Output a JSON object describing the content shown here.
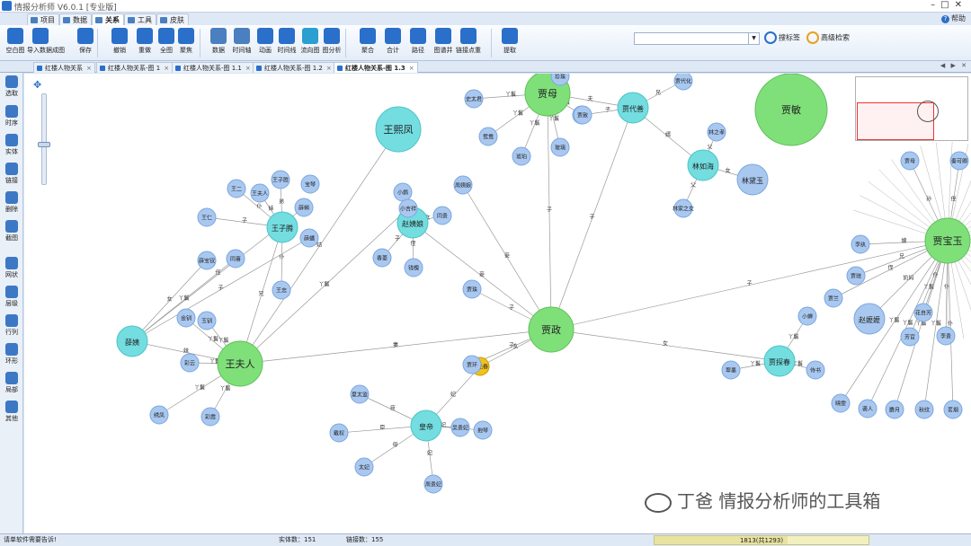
{
  "app": {
    "title": "情报分析师 V6.0.1 [专业版]"
  },
  "menu": {
    "tabs": [
      {
        "label": "项目"
      },
      {
        "label": "数据"
      },
      {
        "label": "关系"
      },
      {
        "label": "工具"
      },
      {
        "label": "皮肤"
      }
    ],
    "help": "帮助"
  },
  "ribbon": {
    "buttons": [
      {
        "label": "空白图"
      },
      {
        "label": "导入数据成图"
      },
      {
        "label": "保存"
      },
      {
        "label": "撤销"
      },
      {
        "label": "重做"
      },
      {
        "label": "全图"
      },
      {
        "label": "聚焦"
      },
      {
        "label": "数据"
      },
      {
        "label": "时间轴"
      },
      {
        "label": "动画"
      },
      {
        "label": "时间线"
      },
      {
        "label": "流向图"
      },
      {
        "label": "图分析"
      },
      {
        "label": "聚合"
      },
      {
        "label": "合计"
      },
      {
        "label": "路径"
      },
      {
        "label": "图谱并"
      },
      {
        "label": "链接点重"
      },
      {
        "label": "提取"
      }
    ],
    "search_placeholder": "",
    "tag_search": "搜标签",
    "advanced_search": "高级检索"
  },
  "doc_tabs": [
    {
      "label": "红楼人物关系"
    },
    {
      "label": "红楼人物关系-图 1"
    },
    {
      "label": "红楼人物关系-图 1.1"
    },
    {
      "label": "红楼人物关系-图 1.2"
    },
    {
      "label": "红楼人物关系-图 1.3"
    }
  ],
  "left_tools": [
    {
      "label": "选取"
    },
    {
      "label": "时序"
    },
    {
      "label": "实体"
    },
    {
      "label": "链接"
    },
    {
      "label": "删除"
    },
    {
      "label": "截图"
    },
    {
      "label": "网状"
    },
    {
      "label": "层级"
    },
    {
      "label": "行列"
    },
    {
      "label": "环形"
    },
    {
      "label": "局部"
    },
    {
      "label": "其他"
    }
  ],
  "graph": {
    "nodes": [
      {
        "id": "wangxifeng",
        "label": "王熙凤",
        "type": "cyan",
        "size": "big"
      },
      {
        "id": "jiamu",
        "label": "贾母",
        "type": "green",
        "size": "big"
      },
      {
        "id": "jiazheng",
        "label": "贾政",
        "type": "green",
        "size": "big"
      },
      {
        "id": "wangfuren",
        "label": "王夫人",
        "type": "green",
        "size": "big"
      },
      {
        "id": "jiabaoyu",
        "label": "贾宝玉",
        "type": "green",
        "size": "big"
      },
      {
        "id": "jiamin",
        "label": "贾敏",
        "type": "green",
        "size": "huge"
      },
      {
        "id": "jiayuanchun",
        "label": "贾元春",
        "type": "gold",
        "size": "small"
      },
      {
        "id": "zhaoyiniang",
        "label": "赵姨娘",
        "type": "cyan",
        "size": "mid"
      },
      {
        "id": "jiadaishan",
        "label": "贾代善",
        "type": "cyan",
        "size": "mid"
      },
      {
        "id": "lingruhai",
        "label": "林如海",
        "type": "cyan",
        "size": "mid"
      },
      {
        "id": "lindaiyu",
        "label": "林黛玉",
        "type": "light",
        "size": "mid"
      },
      {
        "id": "wangzisheng",
        "label": "王子腾",
        "type": "cyan",
        "size": "mid"
      },
      {
        "id": "xuepan",
        "label": "薛姨",
        "type": "cyan",
        "size": "mid"
      },
      {
        "id": "huangdi",
        "label": "皇帝",
        "type": "cyan",
        "size": "mid"
      },
      {
        "id": "jiatanchun",
        "label": "贾探春",
        "type": "cyan",
        "size": "mid"
      },
      {
        "id": "zhaoyima",
        "label": "赵嬷嬷",
        "type": "light",
        "size": "mid"
      },
      {
        "id": "n01",
        "label": "史太君",
        "type": "light",
        "size": "small"
      },
      {
        "id": "n02",
        "label": "鸳鸯",
        "type": "light",
        "size": "small"
      },
      {
        "id": "n03",
        "label": "琥珀",
        "type": "light",
        "size": "small"
      },
      {
        "id": "n04",
        "label": "玻璃",
        "type": "light",
        "size": "small"
      },
      {
        "id": "n05",
        "label": "翡翠",
        "type": "light",
        "size": "small"
      },
      {
        "id": "n06",
        "label": "珍珠",
        "type": "light",
        "size": "small"
      },
      {
        "id": "n07",
        "label": "贾赦",
        "type": "light",
        "size": "small"
      },
      {
        "id": "n08",
        "label": "贾代化",
        "type": "light",
        "size": "small"
      },
      {
        "id": "n09",
        "label": "林家之女",
        "type": "light",
        "size": "small"
      },
      {
        "id": "n10",
        "label": "贾环",
        "type": "light",
        "size": "small"
      },
      {
        "id": "n11",
        "label": "贾珠",
        "type": "light",
        "size": "small"
      },
      {
        "id": "n12",
        "label": "小鹊",
        "type": "light",
        "size": "small"
      },
      {
        "id": "n13",
        "label": "钱槐",
        "type": "light",
        "size": "small"
      },
      {
        "id": "n14",
        "label": "周姨娘",
        "type": "light",
        "size": "small"
      },
      {
        "id": "n15",
        "label": "小吉祥",
        "type": "light",
        "size": "small"
      },
      {
        "id": "n16",
        "label": "金钏",
        "type": "light",
        "size": "small"
      },
      {
        "id": "n17",
        "label": "玉钏",
        "type": "light",
        "size": "small"
      },
      {
        "id": "n18",
        "label": "彩云",
        "type": "light",
        "size": "small"
      },
      {
        "id": "n19",
        "label": "彩霞",
        "type": "light",
        "size": "small"
      },
      {
        "id": "n20",
        "label": "绣凤",
        "type": "light",
        "size": "small"
      },
      {
        "id": "n21",
        "label": "王仁",
        "type": "light",
        "size": "small"
      },
      {
        "id": "n22",
        "label": "王子胜",
        "type": "light",
        "size": "small"
      },
      {
        "id": "n23",
        "label": "王夫人",
        "type": "light",
        "size": "small"
      },
      {
        "id": "n24",
        "label": "薛蝌",
        "type": "light",
        "size": "small"
      },
      {
        "id": "n25",
        "label": "薛蟠",
        "type": "light",
        "size": "small"
      },
      {
        "id": "n26",
        "label": "薛宝钗",
        "type": "light",
        "size": "small"
      },
      {
        "id": "n27",
        "label": "同喜",
        "type": "light",
        "size": "small"
      },
      {
        "id": "n28",
        "label": "同贵",
        "type": "light",
        "size": "small"
      },
      {
        "id": "n29",
        "label": "香菱",
        "type": "light",
        "size": "small"
      },
      {
        "id": "n30",
        "label": "宝琴",
        "type": "light",
        "size": "small"
      },
      {
        "id": "n31",
        "label": "王二",
        "type": "light",
        "size": "small"
      },
      {
        "id": "n32",
        "label": "王忠",
        "type": "light",
        "size": "small"
      },
      {
        "id": "n33",
        "label": "夏太监",
        "type": "light",
        "size": "small"
      },
      {
        "id": "n34",
        "label": "戴权",
        "type": "light",
        "size": "small"
      },
      {
        "id": "n35",
        "label": "太妃",
        "type": "light",
        "size": "small"
      },
      {
        "id": "n36",
        "label": "周贵妃",
        "type": "light",
        "size": "small"
      },
      {
        "id": "n37",
        "label": "吴贵妃",
        "type": "light",
        "size": "small"
      },
      {
        "id": "n38",
        "label": "抱琴",
        "type": "light",
        "size": "small"
      },
      {
        "id": "n39",
        "label": "侍书",
        "type": "light",
        "size": "small"
      },
      {
        "id": "n40",
        "label": "翠墨",
        "type": "light",
        "size": "small"
      },
      {
        "id": "n41",
        "label": "小蝉",
        "type": "light",
        "size": "small"
      },
      {
        "id": "n42",
        "label": "晴雯",
        "type": "light",
        "size": "small"
      },
      {
        "id": "n43",
        "label": "袭人",
        "type": "light",
        "size": "small"
      },
      {
        "id": "n44",
        "label": "麝月",
        "type": "light",
        "size": "small"
      },
      {
        "id": "n45",
        "label": "秋纹",
        "type": "light",
        "size": "small"
      },
      {
        "id": "n46",
        "label": "茗烟",
        "type": "light",
        "size": "small"
      },
      {
        "id": "n47",
        "label": "李贵",
        "type": "light",
        "size": "small"
      },
      {
        "id": "n48",
        "label": "芳官",
        "type": "light",
        "size": "small"
      },
      {
        "id": "n49",
        "label": "花自芳",
        "type": "light",
        "size": "small"
      },
      {
        "id": "n50",
        "label": "贾兰",
        "type": "light",
        "size": "small"
      },
      {
        "id": "n51",
        "label": "李纨",
        "type": "light",
        "size": "small"
      },
      {
        "id": "n52",
        "label": "贾琏",
        "type": "light",
        "size": "small"
      },
      {
        "id": "n53",
        "label": "林之孝",
        "type": "light",
        "size": "small"
      },
      {
        "id": "n54",
        "label": "贾母",
        "type": "light",
        "size": "small"
      },
      {
        "id": "n55",
        "label": "秦可卿",
        "type": "light",
        "size": "small"
      }
    ],
    "edges": [
      {
        "from": "jiazheng",
        "to": "jiamu",
        "label": "子"
      },
      {
        "from": "jiazheng",
        "to": "wangfuren",
        "label": "妻"
      },
      {
        "from": "jiazheng",
        "to": "zhaoyiniang",
        "label": "妾"
      },
      {
        "from": "jiazheng",
        "to": "jiadaishan",
        "label": "子"
      },
      {
        "from": "jiazheng",
        "to": "jiabaoyu",
        "label": "子"
      },
      {
        "from": "jiazheng",
        "to": "jiatanchun",
        "label": "女"
      },
      {
        "from": "jiazheng",
        "to": "jiayuanchun",
        "label": "女"
      },
      {
        "from": "jiazheng",
        "to": "n11",
        "label": "子"
      },
      {
        "from": "jiazheng",
        "to": "n10",
        "label": "子"
      },
      {
        "from": "jiazheng",
        "to": "n14",
        "label": "妾"
      },
      {
        "from": "wangfuren",
        "to": "wangxifeng",
        "label": "姑"
      },
      {
        "from": "wangfuren",
        "to": "wangzisheng",
        "label": "兄"
      },
      {
        "from": "wangfuren",
        "to": "xuepan",
        "label": "妹"
      },
      {
        "from": "wangfuren",
        "to": "n16",
        "label": "丫鬟"
      },
      {
        "from": "wangfuren",
        "to": "n17",
        "label": "丫鬟"
      },
      {
        "from": "wangfuren",
        "to": "n18",
        "label": "丫鬟"
      },
      {
        "from": "wangfuren",
        "to": "n19",
        "label": "丫鬟"
      },
      {
        "from": "wangfuren",
        "to": "n20",
        "label": "丫鬟"
      },
      {
        "from": "wangfuren",
        "to": "n15",
        "label": "丫鬟"
      },
      {
        "from": "wangzisheng",
        "to": "n21",
        "label": "子"
      },
      {
        "from": "wangzisheng",
        "to": "n22",
        "label": "弟"
      },
      {
        "from": "wangzisheng",
        "to": "n23",
        "label": "妹"
      },
      {
        "from": "wangzisheng",
        "to": "n31",
        "label": "仆"
      },
      {
        "from": "wangzisheng",
        "to": "n32",
        "label": "仆"
      },
      {
        "from": "xuepan",
        "to": "n24",
        "label": "侄"
      },
      {
        "from": "xuepan",
        "to": "n25",
        "label": "子"
      },
      {
        "from": "xuepan",
        "to": "n26",
        "label": "女"
      },
      {
        "from": "xuepan",
        "to": "n27",
        "label": "丫鬟"
      },
      {
        "from": "jiamu",
        "to": "n01",
        "label": "丫鬟"
      },
      {
        "from": "jiamu",
        "to": "n02",
        "label": "丫鬟"
      },
      {
        "from": "jiamu",
        "to": "n03",
        "label": "丫鬟"
      },
      {
        "from": "jiamu",
        "to": "n04",
        "label": "丫鬟"
      },
      {
        "from": "jiamu",
        "to": "n05",
        "label": "丫鬟"
      },
      {
        "from": "jiamu",
        "to": "n06",
        "label": "丫鬟"
      },
      {
        "from": "jiamu",
        "to": "jiadaishan",
        "label": "夫"
      },
      {
        "from": "jiadaishan",
        "to": "n07",
        "label": "子"
      },
      {
        "from": "jiadaishan",
        "to": "n08",
        "label": "兄"
      },
      {
        "from": "jiadaishan",
        "to": "lingruhai",
        "label": "婿"
      },
      {
        "from": "lingruhai",
        "to": "lindaiyu",
        "label": "女"
      },
      {
        "from": "lingruhai",
        "to": "n09",
        "label": "父"
      },
      {
        "from": "lingruhai",
        "to": "n53",
        "label": "父"
      },
      {
        "from": "zhaoyiniang",
        "to": "n12",
        "label": "丫鬟"
      },
      {
        "from": "zhaoyiniang",
        "to": "n13",
        "label": "侄"
      },
      {
        "from": "zhaoyiniang",
        "to": "n28",
        "label": "女"
      },
      {
        "from": "zhaoyiniang",
        "to": "n29",
        "label": "子"
      },
      {
        "from": "jiayuanchun",
        "to": "huangdi",
        "label": "妃"
      },
      {
        "from": "huangdi",
        "to": "n33",
        "label": "臣"
      },
      {
        "from": "huangdi",
        "to": "n34",
        "label": "臣"
      },
      {
        "from": "huangdi",
        "to": "n35",
        "label": "母"
      },
      {
        "from": "huangdi",
        "to": "n36",
        "label": "妃"
      },
      {
        "from": "huangdi",
        "to": "n37",
        "label": "妃"
      },
      {
        "from": "huangdi",
        "to": "n38",
        "label": "仆"
      },
      {
        "from": "jiatanchun",
        "to": "n39",
        "label": "丫鬟"
      },
      {
        "from": "jiatanchun",
        "to": "n40",
        "label": "丫鬟"
      },
      {
        "from": "jiatanchun",
        "to": "n41",
        "label": "丫鬟"
      },
      {
        "from": "jiabaoyu",
        "to": "n42",
        "label": "丫鬟"
      },
      {
        "from": "jiabaoyu",
        "to": "n43",
        "label": "丫鬟"
      },
      {
        "from": "jiabaoyu",
        "to": "n44",
        "label": "丫鬟"
      },
      {
        "from": "jiabaoyu",
        "to": "n45",
        "label": "丫鬟"
      },
      {
        "from": "jiabaoyu",
        "to": "n46",
        "label": "仆"
      },
      {
        "from": "jiabaoyu",
        "to": "n47",
        "label": "仆"
      },
      {
        "from": "jiabaoyu",
        "to": "n48",
        "label": "丫鬟"
      },
      {
        "from": "jiabaoyu",
        "to": "n49",
        "label": "仆"
      },
      {
        "from": "jiabaoyu",
        "to": "zhaoyima",
        "label": "奶妈"
      },
      {
        "from": "jiabaoyu",
        "to": "n50",
        "label": "侄"
      },
      {
        "from": "jiabaoyu",
        "to": "n51",
        "label": "嫂"
      },
      {
        "from": "jiabaoyu",
        "to": "n52",
        "label": "兄"
      },
      {
        "from": "jiabaoyu",
        "to": "n54",
        "label": "孙"
      },
      {
        "from": "jiabaoyu",
        "to": "n55",
        "label": "侄"
      }
    ]
  },
  "canvas": {
    "watermark": "丁爸 情报分析师的工具箱"
  },
  "status": {
    "left": "请单软件需要告诉!",
    "entities": "实体数：151",
    "relations": "链接数：155",
    "progress_text": "1813(共1293)",
    "progress": 0.62
  },
  "colors": {
    "green": "#7fe07a",
    "cyan": "#73dde0",
    "light": "#a9c8f0",
    "gold": "#f2c21b",
    "edge": "#9a9a9a",
    "accent": "#2a6fc9"
  }
}
